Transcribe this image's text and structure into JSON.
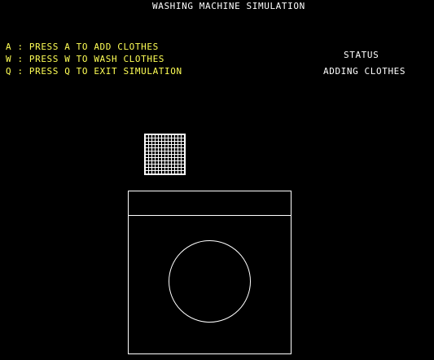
{
  "header": {
    "title": "WASHING MACHINE SIMULATION"
  },
  "controls": {
    "add": "A : PRESS A TO ADD CLOTHES",
    "wash": "W : PRESS W TO WASH CLOTHES",
    "exit": "Q : PRESS Q TO EXIT SIMULATION"
  },
  "status": {
    "label": "STATUS",
    "value": "ADDING CLOTHES"
  },
  "colors": {
    "background": "#000000",
    "title": "#ffffff",
    "controls": "#ffff55",
    "status": "#ffffff",
    "drawing": "#ffffff"
  }
}
